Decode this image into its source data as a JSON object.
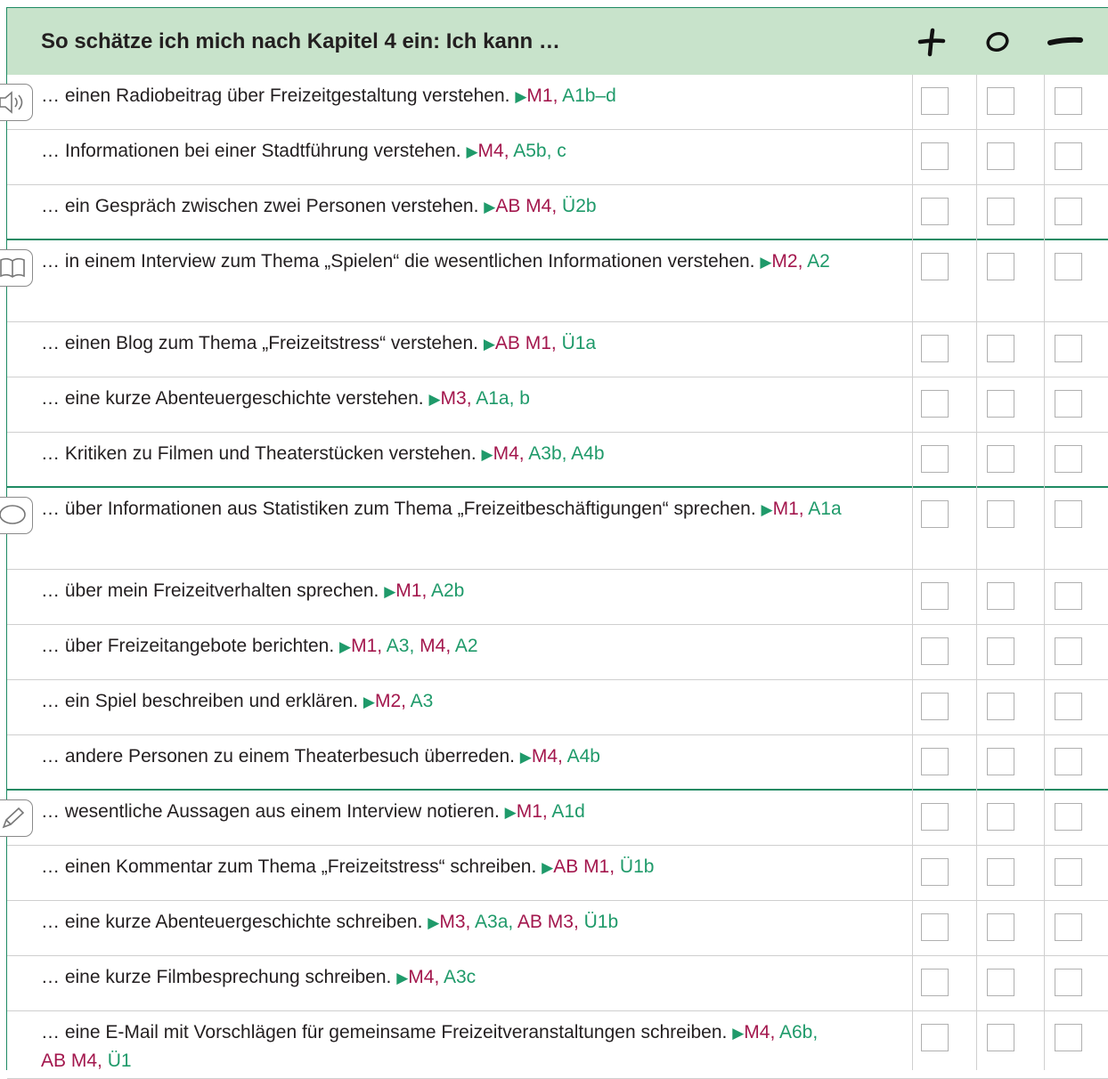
{
  "header": {
    "title": "So schätze ich mich nach Kapitel 4 ein: Ich kann …",
    "col_plus_icon": "plus-icon",
    "col_circle_icon": "circle-icon",
    "col_minus_icon": "minus-icon"
  },
  "colors": {
    "accent": "#1e8a63",
    "header_bg": "#c8e3cb",
    "ref_module": "#a3174d",
    "ref_task": "#1f9a6a"
  },
  "sections": [
    {
      "icon": "speaker-icon",
      "items": [
        {
          "text": "… einen Radiobeitrag über Freizeitgestaltung verstehen.",
          "refs": [
            [
              "M1,",
              "m"
            ],
            [
              "A1b–d",
              "a"
            ]
          ]
        },
        {
          "text": "… Informationen bei einer Stadtführung verstehen.",
          "refs": [
            [
              "M4,",
              "m"
            ],
            [
              "A5b, c",
              "a"
            ]
          ]
        },
        {
          "text": "… ein Gespräch zwischen zwei Personen verstehen.",
          "refs": [
            [
              "AB M4,",
              "m"
            ],
            [
              "Ü2b",
              "a"
            ]
          ]
        }
      ]
    },
    {
      "icon": "book-icon",
      "items": [
        {
          "text": "… in einem Interview zum Thema „Spielen“ die wesentlichen Informationen verstehen.",
          "refs": [
            [
              "M2,",
              "m"
            ],
            [
              "A2",
              "a"
            ]
          ]
        },
        {
          "text": "… einen Blog zum Thema „Freizeitstress“ verstehen.",
          "refs": [
            [
              "AB M1,",
              "m"
            ],
            [
              "Ü1a",
              "a"
            ]
          ]
        },
        {
          "text": "… eine kurze Abenteuergeschichte verstehen.",
          "refs": [
            [
              "M3,",
              "m"
            ],
            [
              "A1a, b",
              "a"
            ]
          ]
        },
        {
          "text": "… Kritiken zu Filmen und Theaterstücken verstehen.",
          "refs": [
            [
              "M4,",
              "m"
            ],
            [
              "A3b, A4b",
              "a"
            ]
          ]
        }
      ]
    },
    {
      "icon": "speech-bubble-icon",
      "items": [
        {
          "text": "… über Informationen aus Statistiken zum Thema „Freizeitbeschäftigungen“ sprechen.",
          "refs": [
            [
              "M1,",
              "m"
            ],
            [
              "A1a",
              "a"
            ]
          ]
        },
        {
          "text": "… über mein Freizeitverhalten sprechen.",
          "refs": [
            [
              "M1,",
              "m"
            ],
            [
              "A2b",
              "a"
            ]
          ]
        },
        {
          "text": "… über Freizeitangebote berichten.",
          "refs": [
            [
              "M1,",
              "m"
            ],
            [
              "A3,",
              "a"
            ],
            [
              "M4,",
              "m"
            ],
            [
              "A2",
              "a"
            ]
          ]
        },
        {
          "text": "… ein Spiel beschreiben und erklären.",
          "refs": [
            [
              "M2,",
              "m"
            ],
            [
              "A3",
              "a"
            ]
          ]
        },
        {
          "text": "… andere Personen zu einem Theaterbesuch überreden.",
          "refs": [
            [
              "M4,",
              "m"
            ],
            [
              "A4b",
              "a"
            ]
          ]
        }
      ]
    },
    {
      "icon": "pencil-icon",
      "items": [
        {
          "text": "… wesentliche Aussagen aus einem Interview notieren.",
          "refs": [
            [
              "M1,",
              "m"
            ],
            [
              "A1d",
              "a"
            ]
          ]
        },
        {
          "text": "… einen Kommentar zum Thema „Freizeitstress“ schreiben.",
          "refs": [
            [
              "AB M1,",
              "m"
            ],
            [
              "Ü1b",
              "a"
            ]
          ]
        },
        {
          "text": "… eine kurze Abenteuergeschichte schreiben.",
          "refs": [
            [
              "M3,",
              "m"
            ],
            [
              "A3a,",
              "a"
            ],
            [
              "AB M3,",
              "m"
            ],
            [
              "Ü1b",
              "a"
            ]
          ]
        },
        {
          "text": "… eine kurze Filmbesprechung schreiben.",
          "refs": [
            [
              "M4,",
              "m"
            ],
            [
              "A3c",
              "a"
            ]
          ]
        },
        {
          "text": "… eine E-Mail mit Vorschlägen für gemeinsame Freizeitveranstaltungen schreiben.",
          "refs": [
            [
              "M4,",
              "m"
            ],
            [
              "A6b,",
              "a"
            ],
            [
              "AB M4,",
              "m"
            ],
            [
              "Ü1",
              "a"
            ]
          ]
        }
      ]
    }
  ]
}
